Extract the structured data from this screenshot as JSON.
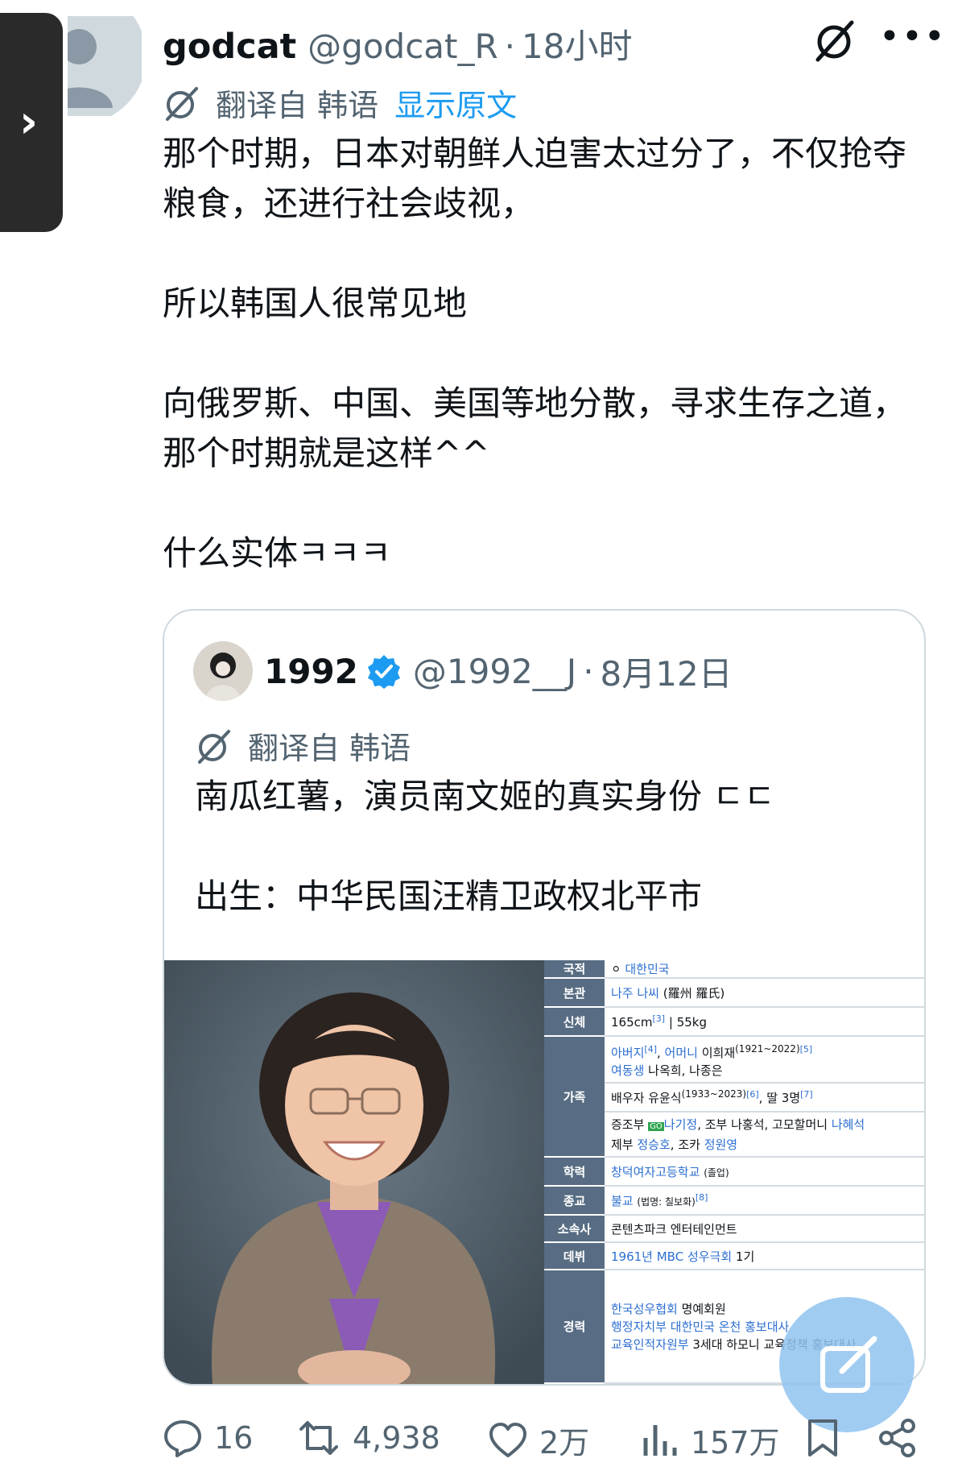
{
  "tweet": {
    "display_name": "godcat",
    "handle": "@godcat_R",
    "separator": "·",
    "time": "18小时",
    "translated_from": "翻译自 韩语",
    "show_original": "显示原文",
    "body": [
      "那个时期，日本对朝鲜人迫害太过分了，不仅抢夺粮食，还进行社会歧视，",
      "所以韩国人很常见地",
      "向俄罗斯、中国、美国等地分散，寻求生存之道，那个时期就是这样^^",
      "什么实体ㅋㅋㅋ"
    ]
  },
  "quoted": {
    "display_name": "1992",
    "handle": "@1992__J",
    "separator": "·",
    "date": "8月12日",
    "translated_from": "翻译自 韩语",
    "body": [
      "南瓜红薯，演员南文姬的真实身份 ㄷㄷ",
      "出生：中华民国汪精卫政权北平市"
    ],
    "infobox": {
      "nationality_label": "국적",
      "nationality_value": "대한민국",
      "bongwan_label": "본관",
      "bongwan_link": "나주 나씨",
      "bongwan_text": "(羅州 羅氏)",
      "body_label": "신체",
      "body_value": "165cm",
      "body_ref": "[3]",
      "body_weight": "| 55kg",
      "family_label": "가족",
      "family_line1_a": "아버지",
      "family_line1_ref1": "[4]",
      "family_line1_b": ", ",
      "family_line1_c": "어머니",
      "family_line1_d": " 이희재",
      "family_line1_years": "(1921~2022)",
      "family_line1_ref2": "[5]",
      "family_line2_a": "여동생",
      "family_line2_b": " 나옥희, 나종은",
      "family_line3_a": "배우자 유윤식",
      "family_line3_years": "(1933~2023)",
      "family_line3_ref": "[6]",
      "family_line3_b": ", 딸 3명",
      "family_line3_ref2": "[7]",
      "family_line4_a": "증조부 ",
      "family_line4_badge": "GO",
      "family_line4_b": "나기정",
      "family_line4_c": ", 조부 나홍석, 고모할머니 ",
      "family_line4_d": "나혜석",
      "family_line5_a": "제부 ",
      "family_line5_b": "정승호",
      "family_line5_c": ", 조카 ",
      "family_line5_d": "정원영",
      "school_label": "학력",
      "school_link": "창덕여자고등학교",
      "school_note": "(졸업)",
      "religion_label": "종교",
      "religion_link": "불교",
      "religion_note": "(법명: 칠보화)",
      "religion_ref": "[8]",
      "agency_label": "소속사",
      "agency_value": "콘텐츠파크 엔터테인먼트",
      "debut_label": "데뷔",
      "debut_link": "1961년 MBC 성우극회",
      "debut_text": " 1기",
      "career_label": "경력",
      "career_line1_a": "한국성우협회",
      "career_line1_b": " 명예회원",
      "career_line2": "행정자치부 대한민국 온천 홍보대사",
      "career_line3_a": "교육인적자원부",
      "career_line3_b": " 3세대 하모니 교육정책 홍보대사"
    }
  },
  "actions": {
    "replies": "16",
    "retweets": "4,938",
    "likes": "2万",
    "views": "157万"
  },
  "colors": {
    "accent": "#1d9bf0",
    "muted": "#536471",
    "infobox_header": "#586d83"
  },
  "icons": [
    "chevron-right-icon",
    "grok-icon",
    "more-icon",
    "translate-icon",
    "verified-badge-icon",
    "reply-icon",
    "retweet-icon",
    "like-icon",
    "views-icon",
    "bookmark-icon",
    "share-icon",
    "compose-icon"
  ]
}
